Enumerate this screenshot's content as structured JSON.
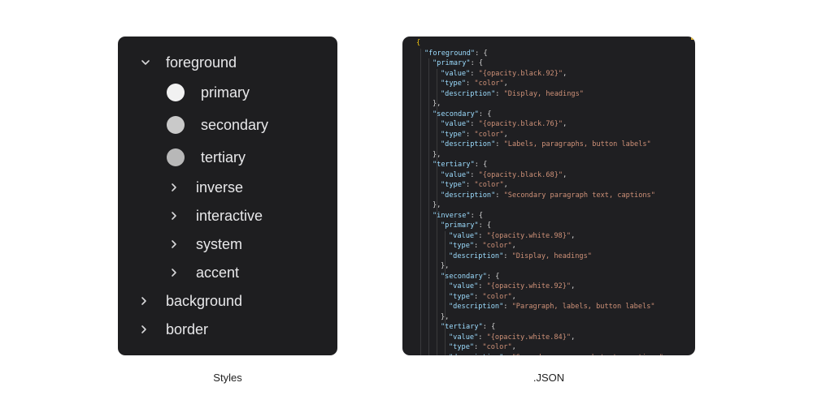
{
  "styles_panel": {
    "caption": "Styles",
    "tree": {
      "root": {
        "label": "foreground",
        "expanded": true
      },
      "swatches": [
        {
          "label": "primary",
          "color": "#f1f1f1"
        },
        {
          "label": "secondary",
          "color": "#c9c9c9"
        },
        {
          "label": "tertiary",
          "color": "#b8b8b8"
        }
      ],
      "subgroups": [
        {
          "label": "inverse"
        },
        {
          "label": "interactive"
        },
        {
          "label": "system"
        },
        {
          "label": "accent"
        }
      ],
      "groups": [
        {
          "label": "background"
        },
        {
          "label": "border"
        }
      ]
    }
  },
  "json_panel": {
    "caption": ".JSON",
    "lines": [
      {
        "indent": 0,
        "tokens": [
          {
            "t": "p",
            "v": "{"
          }
        ]
      },
      {
        "indent": 1,
        "tokens": [
          {
            "t": "k",
            "v": "\"foreground\""
          },
          {
            "t": "p",
            "v": ": {"
          }
        ]
      },
      {
        "indent": 2,
        "tokens": [
          {
            "t": "k",
            "v": "\"primary\""
          },
          {
            "t": "p",
            "v": ": {"
          }
        ]
      },
      {
        "indent": 3,
        "tokens": [
          {
            "t": "k",
            "v": "\"value\""
          },
          {
            "t": "p",
            "v": ": "
          },
          {
            "t": "s",
            "v": "\"{opacity.black.92}\""
          },
          {
            "t": "p",
            "v": ","
          }
        ]
      },
      {
        "indent": 3,
        "tokens": [
          {
            "t": "k",
            "v": "\"type\""
          },
          {
            "t": "p",
            "v": ": "
          },
          {
            "t": "s",
            "v": "\"color\""
          },
          {
            "t": "p",
            "v": ","
          }
        ]
      },
      {
        "indent": 3,
        "tokens": [
          {
            "t": "k",
            "v": "\"description\""
          },
          {
            "t": "p",
            "v": ": "
          },
          {
            "t": "s",
            "v": "\"Display, headings\""
          }
        ]
      },
      {
        "indent": 2,
        "tokens": [
          {
            "t": "p",
            "v": "},"
          }
        ]
      },
      {
        "indent": 2,
        "tokens": [
          {
            "t": "k",
            "v": "\"secondary\""
          },
          {
            "t": "p",
            "v": ": {"
          }
        ]
      },
      {
        "indent": 3,
        "tokens": [
          {
            "t": "k",
            "v": "\"value\""
          },
          {
            "t": "p",
            "v": ": "
          },
          {
            "t": "s",
            "v": "\"{opacity.black.76}\""
          },
          {
            "t": "p",
            "v": ","
          }
        ]
      },
      {
        "indent": 3,
        "tokens": [
          {
            "t": "k",
            "v": "\"type\""
          },
          {
            "t": "p",
            "v": ": "
          },
          {
            "t": "s",
            "v": "\"color\""
          },
          {
            "t": "p",
            "v": ","
          }
        ]
      },
      {
        "indent": 3,
        "tokens": [
          {
            "t": "k",
            "v": "\"description\""
          },
          {
            "t": "p",
            "v": ": "
          },
          {
            "t": "s",
            "v": "\"Labels, paragraphs, button labels\""
          }
        ]
      },
      {
        "indent": 2,
        "tokens": [
          {
            "t": "p",
            "v": "},"
          }
        ]
      },
      {
        "indent": 2,
        "tokens": [
          {
            "t": "k",
            "v": "\"tertiary\""
          },
          {
            "t": "p",
            "v": ": {"
          }
        ]
      },
      {
        "indent": 3,
        "tokens": [
          {
            "t": "k",
            "v": "\"value\""
          },
          {
            "t": "p",
            "v": ": "
          },
          {
            "t": "s",
            "v": "\"{opacity.black.68}\""
          },
          {
            "t": "p",
            "v": ","
          }
        ]
      },
      {
        "indent": 3,
        "tokens": [
          {
            "t": "k",
            "v": "\"type\""
          },
          {
            "t": "p",
            "v": ": "
          },
          {
            "t": "s",
            "v": "\"color\""
          },
          {
            "t": "p",
            "v": ","
          }
        ]
      },
      {
        "indent": 3,
        "tokens": [
          {
            "t": "k",
            "v": "\"description\""
          },
          {
            "t": "p",
            "v": ": "
          },
          {
            "t": "s",
            "v": "\"Secondary paragraph text, captions\""
          }
        ]
      },
      {
        "indent": 2,
        "tokens": [
          {
            "t": "p",
            "v": "},"
          }
        ]
      },
      {
        "indent": 2,
        "tokens": [
          {
            "t": "k",
            "v": "\"inverse\""
          },
          {
            "t": "p",
            "v": ": {"
          }
        ]
      },
      {
        "indent": 3,
        "tokens": [
          {
            "t": "k",
            "v": "\"primary\""
          },
          {
            "t": "p",
            "v": ": {"
          }
        ]
      },
      {
        "indent": 4,
        "tokens": [
          {
            "t": "k",
            "v": "\"value\""
          },
          {
            "t": "p",
            "v": ": "
          },
          {
            "t": "s",
            "v": "\"{opacity.white.98}\""
          },
          {
            "t": "p",
            "v": ","
          }
        ]
      },
      {
        "indent": 4,
        "tokens": [
          {
            "t": "k",
            "v": "\"type\""
          },
          {
            "t": "p",
            "v": ": "
          },
          {
            "t": "s",
            "v": "\"color\""
          },
          {
            "t": "p",
            "v": ","
          }
        ]
      },
      {
        "indent": 4,
        "tokens": [
          {
            "t": "k",
            "v": "\"description\""
          },
          {
            "t": "p",
            "v": ": "
          },
          {
            "t": "s",
            "v": "\"Display, headings\""
          }
        ]
      },
      {
        "indent": 3,
        "tokens": [
          {
            "t": "p",
            "v": "},"
          }
        ]
      },
      {
        "indent": 3,
        "tokens": [
          {
            "t": "k",
            "v": "\"secondary\""
          },
          {
            "t": "p",
            "v": ": {"
          }
        ]
      },
      {
        "indent": 4,
        "tokens": [
          {
            "t": "k",
            "v": "\"value\""
          },
          {
            "t": "p",
            "v": ": "
          },
          {
            "t": "s",
            "v": "\"{opacity.white.92}\""
          },
          {
            "t": "p",
            "v": ","
          }
        ]
      },
      {
        "indent": 4,
        "tokens": [
          {
            "t": "k",
            "v": "\"type\""
          },
          {
            "t": "p",
            "v": ": "
          },
          {
            "t": "s",
            "v": "\"color\""
          },
          {
            "t": "p",
            "v": ","
          }
        ]
      },
      {
        "indent": 4,
        "tokens": [
          {
            "t": "k",
            "v": "\"description\""
          },
          {
            "t": "p",
            "v": ": "
          },
          {
            "t": "s",
            "v": "\"Paragraph, labels, button labels\""
          }
        ]
      },
      {
        "indent": 3,
        "tokens": [
          {
            "t": "p",
            "v": "},"
          }
        ]
      },
      {
        "indent": 3,
        "tokens": [
          {
            "t": "k",
            "v": "\"tertiary\""
          },
          {
            "t": "p",
            "v": ": {"
          }
        ]
      },
      {
        "indent": 4,
        "tokens": [
          {
            "t": "k",
            "v": "\"value\""
          },
          {
            "t": "p",
            "v": ": "
          },
          {
            "t": "s",
            "v": "\"{opacity.white.84}\""
          },
          {
            "t": "p",
            "v": ","
          }
        ]
      },
      {
        "indent": 4,
        "tokens": [
          {
            "t": "k",
            "v": "\"type\""
          },
          {
            "t": "p",
            "v": ": "
          },
          {
            "t": "s",
            "v": "\"color\""
          },
          {
            "t": "p",
            "v": ","
          }
        ]
      },
      {
        "indent": 4,
        "tokens": [
          {
            "t": "k",
            "v": "\"description\""
          },
          {
            "t": "p",
            "v": ": "
          },
          {
            "t": "s",
            "v": "\"Secondary paragraph text, captions\""
          }
        ]
      }
    ]
  }
}
